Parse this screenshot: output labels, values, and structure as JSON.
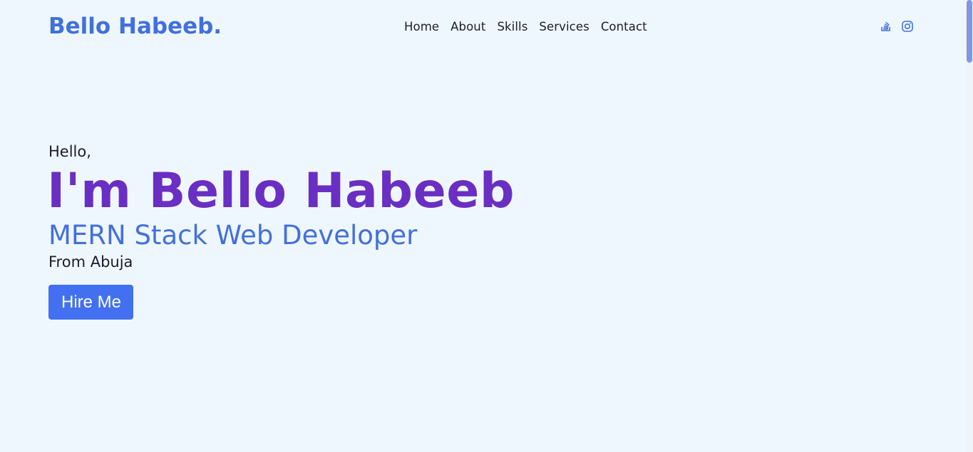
{
  "header": {
    "logo": "Bello Habeeb.",
    "nav": [
      "Home",
      "About",
      "Skills",
      "Services",
      "Contact"
    ],
    "socials": [
      "stack-overflow-icon",
      "instagram-icon"
    ]
  },
  "hero": {
    "greeting": "Hello,",
    "headline": "I'm Bello Habeeb",
    "role": "MERN Stack Web Developer",
    "location": "From Abuja",
    "cta_label": "Hire Me"
  },
  "colors": {
    "background": "#eff7fe",
    "brand_blue": "#4270dc",
    "headline_purple": "#6a2fc2",
    "button_blue": "#4270f0",
    "text_dark": "#1b1b2a"
  }
}
